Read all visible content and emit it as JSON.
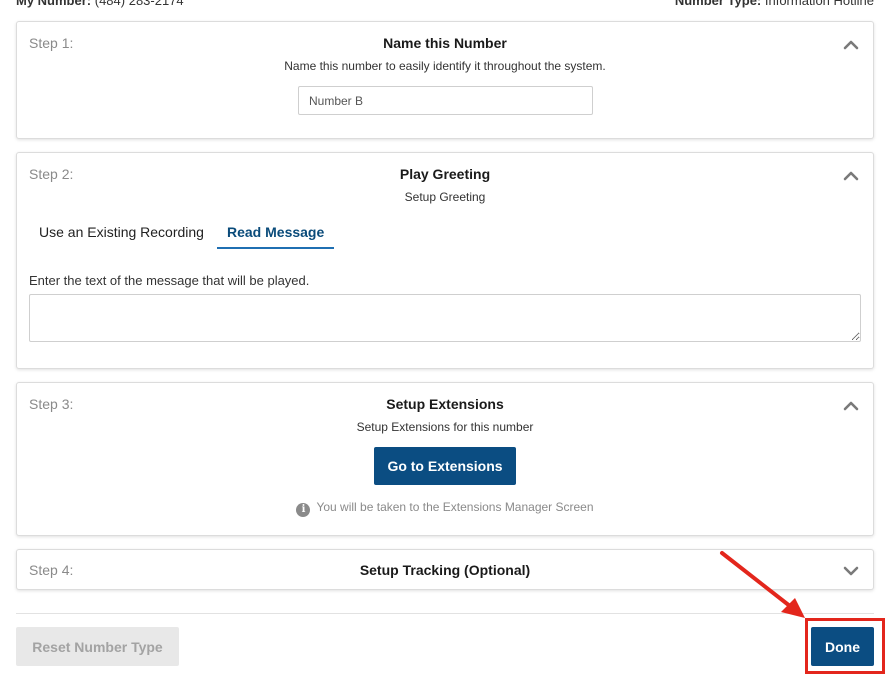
{
  "topbar": {
    "my_number_label": "My Number:",
    "my_number_value": "(484) 283-2174",
    "number_type_label": "Number Type:",
    "number_type_value": "Information Hotline"
  },
  "step1": {
    "step_label": "Step 1:",
    "title": "Name this Number",
    "subtitle": "Name this number to easily identify it throughout the system.",
    "input_value": "Number B",
    "chevron": "chevron-up-icon"
  },
  "step2": {
    "step_label": "Step 2:",
    "title": "Play Greeting",
    "subtitle": "Setup Greeting",
    "tabs": [
      {
        "label": "Use an Existing Recording",
        "active": false
      },
      {
        "label": "Read Message",
        "active": true
      }
    ],
    "message_label": "Enter the text of the message that will be played.",
    "message_value": "",
    "chevron": "chevron-up-icon"
  },
  "step3": {
    "step_label": "Step 3:",
    "title": "Setup Extensions",
    "subtitle": "Setup Extensions for this number",
    "button_label": "Go to Extensions",
    "info_text": "You will be taken to the Extensions Manager Screen",
    "info_icon": "info-circle-icon",
    "chevron": "chevron-up-icon"
  },
  "step4": {
    "step_label": "Step 4:",
    "title": "Setup Tracking (Optional)",
    "chevron": "chevron-down-icon"
  },
  "footer": {
    "reset_label": "Reset Number Type",
    "done_label": "Done"
  },
  "colors": {
    "primary": "#0b4d82",
    "active_tab": "#0a4b7a",
    "highlight": "#e3261c",
    "disabled_bg": "#e8e8e8"
  }
}
